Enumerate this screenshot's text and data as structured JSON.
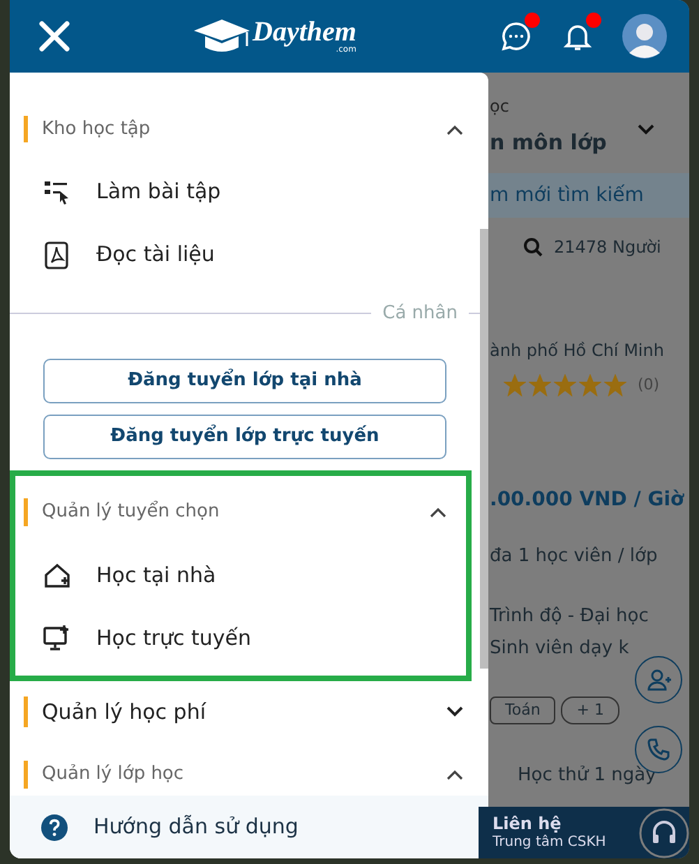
{
  "header": {
    "logo_text": "Daythem",
    "logo_suffix": ".com",
    "icons": [
      {
        "kind": "chat",
        "unread": true
      },
      {
        "kind": "bell",
        "unread": true
      }
    ]
  },
  "drawer": {
    "sections": [
      {
        "kind": "group",
        "title": "Kho học tập",
        "expanded": true,
        "highlighted": false,
        "items": [
          {
            "kind": "exercise",
            "label": "Làm bài tập"
          },
          {
            "kind": "pdf",
            "label": "Đọc tài liệu"
          }
        ]
      },
      {
        "kind": "divider",
        "label": "Cá nhân"
      },
      {
        "kind": "buttons",
        "buttons": [
          "Đăng tuyển lớp tại nhà",
          "Đăng tuyển lớp trực tuyến"
        ]
      },
      {
        "kind": "group",
        "title": "Quản lý tuyển chọn",
        "expanded": true,
        "highlighted": true,
        "items": [
          {
            "kind": "home",
            "label": "Học tại nhà"
          },
          {
            "kind": "monitor",
            "label": "Học trực tuyến"
          }
        ]
      },
      {
        "kind": "group",
        "title": "Quản lý học phí",
        "expanded": false,
        "highlighted": false
      },
      {
        "kind": "group",
        "title": "Quản lý lớp học",
        "expanded": true,
        "highlighted": false
      }
    ],
    "footer": "Hướng dẫn sử dụng"
  },
  "background": {
    "location_label": "ọc",
    "subject_select": "n môn lớp",
    "new_search_button": "m mới tìm kiếm",
    "count": "21478 Người",
    "card": {
      "city": "ành phố Hồ Chí Minh",
      "stars": 5,
      "review_count": "(0)",
      "price": ".00.000 VND / Giờ",
      "students": "đa 1 học viên / lớp",
      "level": "Trình độ - Đại học",
      "tutor_type": "Sinh viên dạy k",
      "tags": [
        "Toán",
        "+ 1"
      ],
      "trial": "Học thử 1 ngày"
    },
    "contact": {
      "title": "Liên hệ",
      "subtitle": "Trung tâm CSKH"
    }
  }
}
